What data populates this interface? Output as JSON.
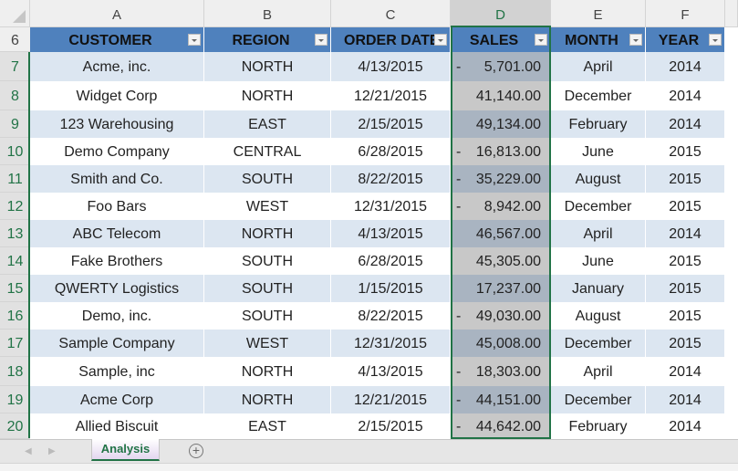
{
  "column_letters": [
    "A",
    "B",
    "C",
    "D",
    "E",
    "F"
  ],
  "selected_column": "D",
  "header_row_number": "6",
  "table_headers": [
    "CUSTOMER",
    "REGION",
    "ORDER DATE",
    "SALES",
    "MONTH",
    "YEAR"
  ],
  "rows": [
    {
      "row": "7",
      "customer": "Acme, inc.",
      "region": "NORTH",
      "order_date": "4/13/2015",
      "sales_sign": "-",
      "sales": "5,701.00",
      "month": "April",
      "year": "2014"
    },
    {
      "row": "8",
      "customer": "Widget Corp",
      "region": "NORTH",
      "order_date": "12/21/2015",
      "sales_sign": "",
      "sales": "41,140.00",
      "month": "December",
      "year": "2014"
    },
    {
      "row": "9",
      "customer": "123 Warehousing",
      "region": "EAST",
      "order_date": "2/15/2015",
      "sales_sign": "",
      "sales": "49,134.00",
      "month": "February",
      "year": "2014"
    },
    {
      "row": "10",
      "customer": "Demo Company",
      "region": "CENTRAL",
      "order_date": "6/28/2015",
      "sales_sign": "-",
      "sales": "16,813.00",
      "month": "June",
      "year": "2015"
    },
    {
      "row": "11",
      "customer": "Smith and Co.",
      "region": "SOUTH",
      "order_date": "8/22/2015",
      "sales_sign": "-",
      "sales": "35,229.00",
      "month": "August",
      "year": "2015"
    },
    {
      "row": "12",
      "customer": "Foo Bars",
      "region": "WEST",
      "order_date": "12/31/2015",
      "sales_sign": "-",
      "sales": "8,942.00",
      "month": "December",
      "year": "2015"
    },
    {
      "row": "13",
      "customer": "ABC Telecom",
      "region": "NORTH",
      "order_date": "4/13/2015",
      "sales_sign": "",
      "sales": "46,567.00",
      "month": "April",
      "year": "2014"
    },
    {
      "row": "14",
      "customer": "Fake Brothers",
      "region": "SOUTH",
      "order_date": "6/28/2015",
      "sales_sign": "",
      "sales": "45,305.00",
      "month": "June",
      "year": "2015"
    },
    {
      "row": "15",
      "customer": "QWERTY Logistics",
      "region": "SOUTH",
      "order_date": "1/15/2015",
      "sales_sign": "",
      "sales": "17,237.00",
      "month": "January",
      "year": "2015"
    },
    {
      "row": "16",
      "customer": "Demo, inc.",
      "region": "SOUTH",
      "order_date": "8/22/2015",
      "sales_sign": "-",
      "sales": "49,030.00",
      "month": "August",
      "year": "2015"
    },
    {
      "row": "17",
      "customer": "Sample Company",
      "region": "WEST",
      "order_date": "12/31/2015",
      "sales_sign": "",
      "sales": "45,008.00",
      "month": "December",
      "year": "2015"
    },
    {
      "row": "18",
      "customer": "Sample, inc",
      "region": "NORTH",
      "order_date": "4/13/2015",
      "sales_sign": "-",
      "sales": "18,303.00",
      "month": "April",
      "year": "2014"
    },
    {
      "row": "19",
      "customer": "Acme Corp",
      "region": "NORTH",
      "order_date": "12/21/2015",
      "sales_sign": "-",
      "sales": "44,151.00",
      "month": "December",
      "year": "2014"
    },
    {
      "row": "20",
      "customer": "Allied Biscuit",
      "region": "EAST",
      "order_date": "2/15/2015",
      "sales_sign": "-",
      "sales": "44,642.00",
      "month": "February",
      "year": "2014"
    }
  ],
  "sheet_tabs": [
    {
      "label": "Analysis",
      "active": true
    }
  ],
  "icons": {
    "nav_prev": "◀",
    "nav_next": "▶",
    "add_sheet": "+"
  },
  "colors": {
    "header_fill": "#4f81bd",
    "band_fill": "#dce6f1",
    "selection": "#217346",
    "active_tab_text": "#217346"
  }
}
